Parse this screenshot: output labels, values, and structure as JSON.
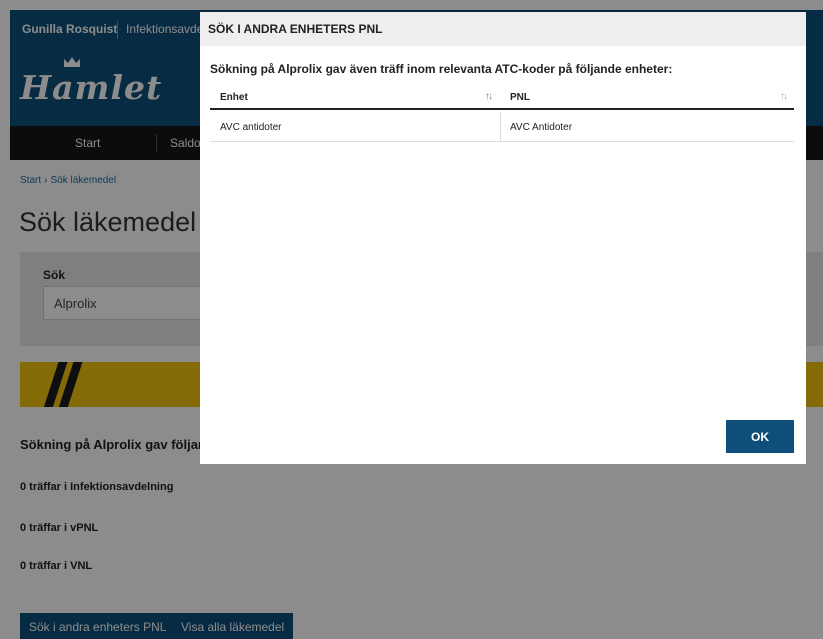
{
  "header": {
    "user": "Gunilla Rosquist",
    "unit": "Infektionsavdelning",
    "logo": "Hamlet"
  },
  "nav": {
    "items": [
      "Start",
      "Saldo"
    ]
  },
  "breadcrumb": {
    "home": "Start",
    "current": "Sök läkemedel"
  },
  "page": {
    "title": "Sök läkemedel",
    "search_label": "Sök",
    "search_value": "Alprolix",
    "result_heading": "Sökning på Alprolix gav följande",
    "hits": [
      "0 träffar i Infektionsavdelning",
      "0 träffar i vPNL",
      "0 träffar i VNL"
    ],
    "buttons": {
      "search_other": "Sök i andra enheters PNL",
      "show_all": "Visa alla läkemedel"
    }
  },
  "modal": {
    "title": "SÖK I ANDRA ENHETERS PNL",
    "subtitle": "Sökning på Alprolix gav även träff inom relevanta ATC-koder på följande enheter:",
    "columns": [
      "Enhet",
      "PNL"
    ],
    "rows": [
      {
        "enhet": "AVC antidoter",
        "pnl": "AVC Antidoter"
      }
    ],
    "ok_label": "OK"
  },
  "icons": {
    "sort": "sort-arrows-icon",
    "crown": "crown-icon",
    "chevron": "chevron-right-icon"
  },
  "colors": {
    "brand": "#0e4f7a",
    "nav": "#161616",
    "stripe": "#f2c40f"
  }
}
